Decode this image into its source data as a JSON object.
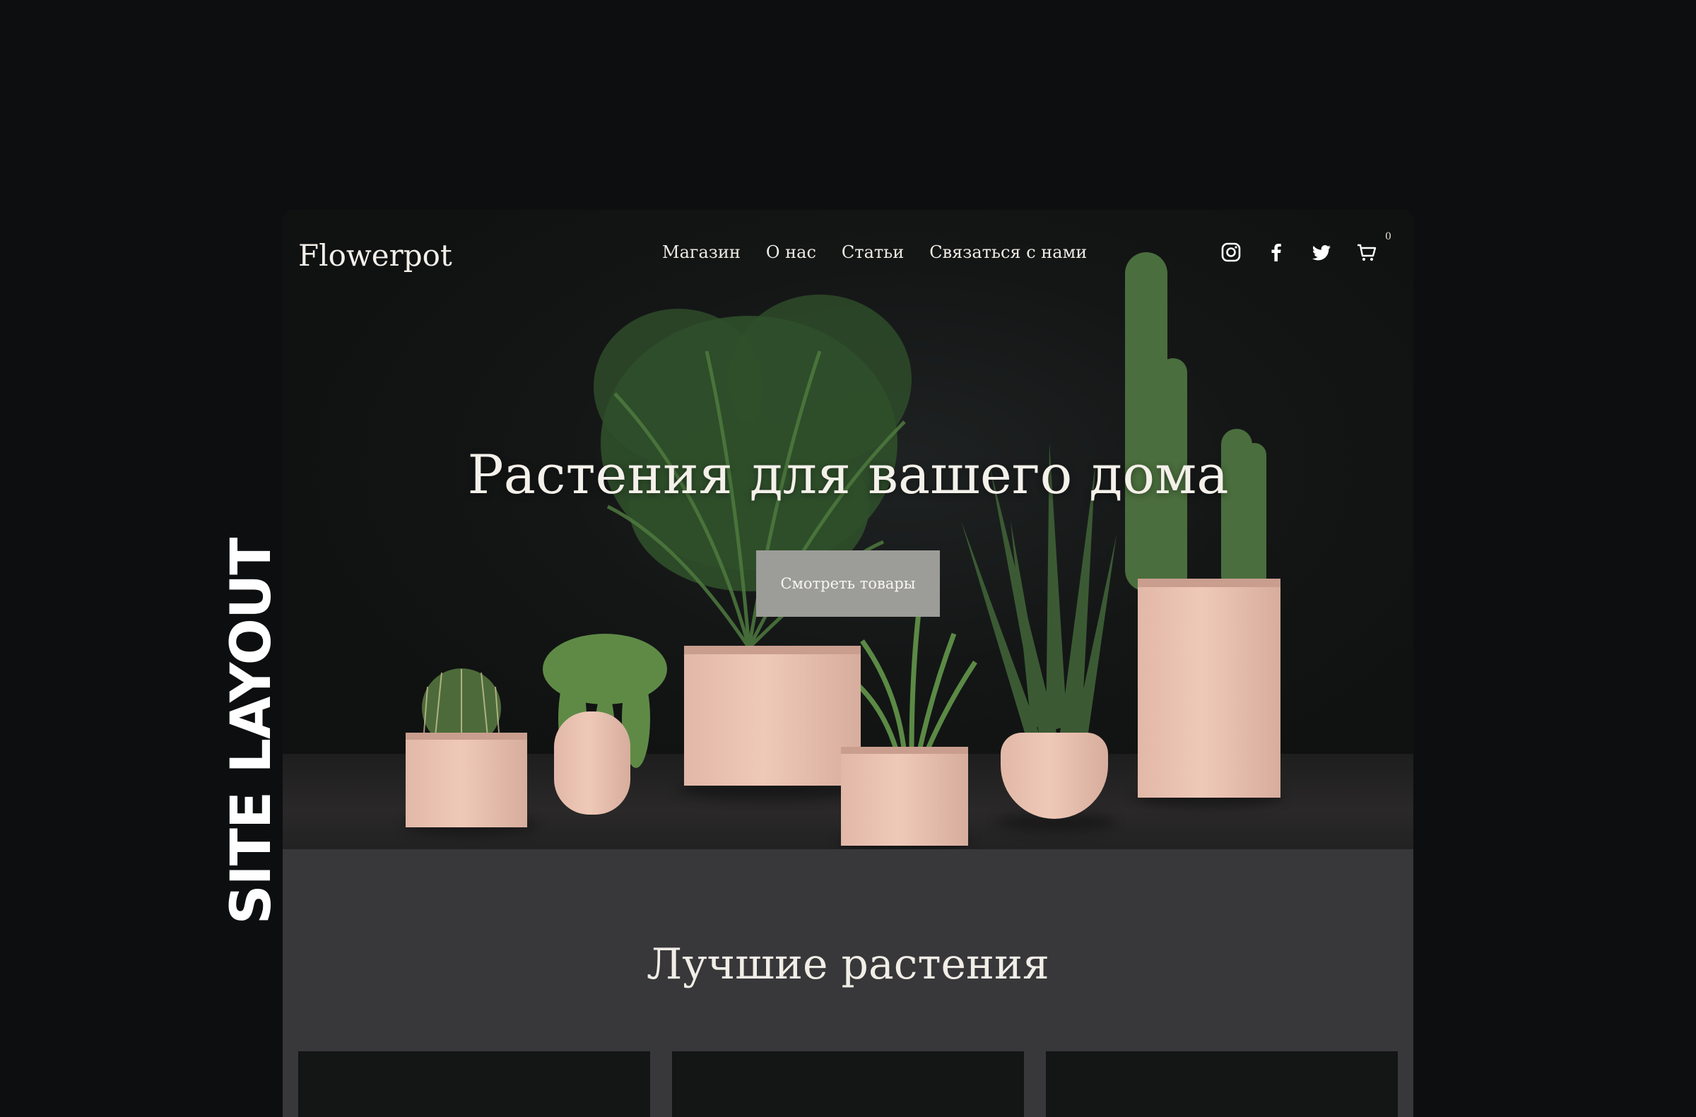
{
  "side_label": "SITE LAYOUT",
  "header": {
    "logo": "Flowerpot",
    "nav": [
      "Магазин",
      "О нас",
      "Статьи",
      "Связаться с нами"
    ],
    "icons": [
      "instagram-icon",
      "facebook-icon",
      "twitter-icon",
      "cart-icon"
    ],
    "cart_count": "0"
  },
  "hero": {
    "title": "Растения для вашего дома",
    "cta_label": "Смотреть товары"
  },
  "best": {
    "title": "Лучшие растения"
  },
  "colors": {
    "page_bg": "#0d0e10",
    "hero_bg": "#141616",
    "section_bg": "#38383a",
    "button_bg": "#9c9c98",
    "pot": "#efc9b8",
    "foliage": "#3f6a38"
  }
}
